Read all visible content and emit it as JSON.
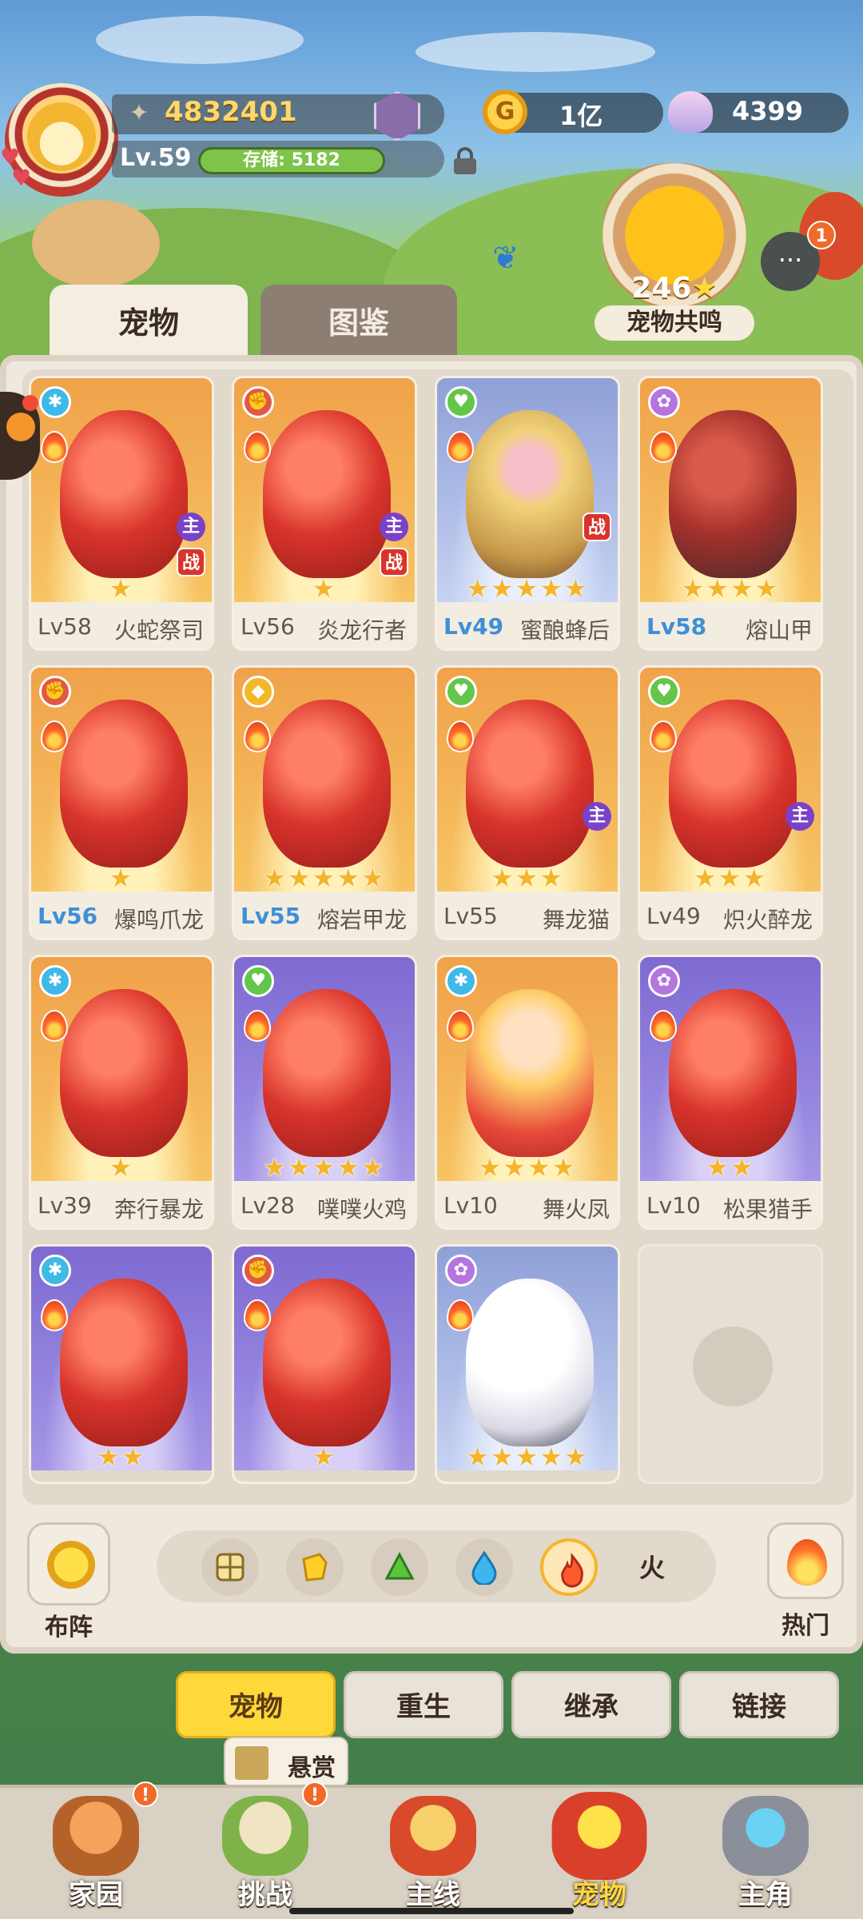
{
  "header": {
    "power": "4832401",
    "level": "Lv.59",
    "storage": "存储: 5182",
    "coins": "1亿",
    "shells": "4399",
    "resonance_count": "246",
    "resonance_label": "宠物共鸣",
    "chat_badge": "1"
  },
  "tabs": [
    {
      "label": "宠物",
      "active": true
    },
    {
      "label": "图鉴",
      "active": false
    }
  ],
  "pets": [
    {
      "level": "Lv58",
      "name": "火蛇祭司",
      "stars": 1,
      "element": "speed",
      "tags": [
        "主",
        "战"
      ]
    },
    {
      "level": "Lv56",
      "name": "炎龙行者",
      "stars": 1,
      "element": "power",
      "tags": [
        "主",
        "战"
      ]
    },
    {
      "level": "Lv49",
      "name": "蜜酿蜂后",
      "stars": 5,
      "element": "heal",
      "tags": [
        "战"
      ]
    },
    {
      "level": "Lv58",
      "name": "熔山甲",
      "stars": 4,
      "element": "magic",
      "tags": []
    },
    {
      "level": "Lv56",
      "name": "爆鸣爪龙",
      "stars": 1,
      "element": "power",
      "tags": []
    },
    {
      "level": "Lv55",
      "name": "熔岩甲龙",
      "stars": 5,
      "element": "def",
      "tags": []
    },
    {
      "level": "Lv55",
      "name": "舞龙猫",
      "stars": 3,
      "element": "heal",
      "tags": [
        "主"
      ]
    },
    {
      "level": "Lv49",
      "name": "炽火醉龙",
      "stars": 3,
      "element": "heal",
      "tags": [
        "主"
      ]
    },
    {
      "level": "Lv39",
      "name": "奔行暴龙",
      "stars": 1,
      "element": "speed",
      "tags": []
    },
    {
      "level": "Lv28",
      "name": "噗噗火鸡",
      "stars": 5,
      "element": "heal",
      "tags": []
    },
    {
      "level": "Lv10",
      "name": "舞火凤",
      "stars": 4,
      "element": "speed",
      "tags": []
    },
    {
      "level": "Lv10",
      "name": "松果猎手",
      "stars": 2,
      "element": "magic",
      "tags": []
    },
    {
      "level": "",
      "name": "",
      "stars": 2,
      "element": "speed",
      "tags": []
    },
    {
      "level": "",
      "name": "",
      "stars": 1,
      "element": "power",
      "tags": []
    },
    {
      "level": "",
      "name": "",
      "stars": 5,
      "element": "magic",
      "tags": []
    }
  ],
  "controls": {
    "formation_label": "布阵",
    "filter_selected_label": "火",
    "hot_label": "热门"
  },
  "actions": [
    {
      "label": "宠物",
      "active": true
    },
    {
      "label": "重生",
      "active": false
    },
    {
      "label": "继承",
      "active": false
    },
    {
      "label": "链接",
      "active": false
    }
  ],
  "bounty_label": "悬赏",
  "nav": [
    {
      "label": "家园",
      "badge": "!"
    },
    {
      "label": "挑战",
      "badge": "!"
    },
    {
      "label": "主线",
      "badge": ""
    },
    {
      "label": "宠物",
      "badge": ""
    },
    {
      "label": "主角",
      "badge": ""
    }
  ],
  "colors": {
    "accent": "#ffd83a",
    "level_highlight": "#3d8fd8",
    "badge": "#f06a2a"
  }
}
